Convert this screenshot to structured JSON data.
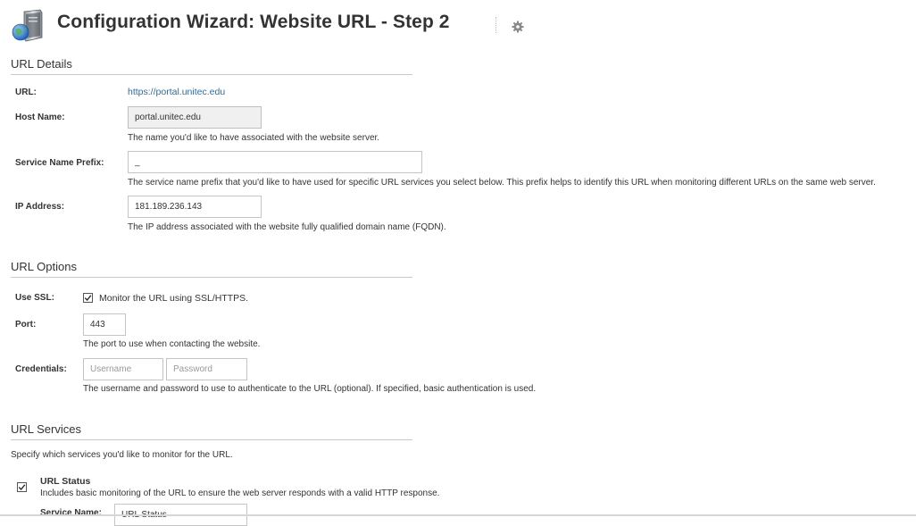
{
  "page": {
    "title": "Configuration Wizard: Website URL - Step 2",
    "icon": "server-globe-icon",
    "settings_icon": "gear-icon"
  },
  "url_details": {
    "heading": "URL Details",
    "url_label": "URL:",
    "url_value": "https://portal.unitec.edu",
    "host_name_label": "Host Name:",
    "host_name_value": "portal.unitec.edu",
    "host_name_help": "The name you'd like to have associated with the website server.",
    "prefix_label": "Service Name Prefix:",
    "prefix_value": "_",
    "prefix_help": "The service name prefix that you'd like to have used for specific URL services you select below. This prefix helps to identify this URL when monitoring different URLs on the same web server.",
    "ip_label": "IP Address:",
    "ip_value": "181.189.236.143",
    "ip_help": "The IP address associated with the website fully qualified domain name (FQDN)."
  },
  "url_options": {
    "heading": "URL Options",
    "ssl_label": "Use SSL:",
    "ssl_checked": true,
    "ssl_text": "Monitor the URL using SSL/HTTPS.",
    "port_label": "Port:",
    "port_value": "443",
    "port_help": "The port to use when contacting the website.",
    "credentials_label": "Credentials:",
    "username_placeholder": "Username",
    "password_placeholder": "Password",
    "credentials_help": "The username and password to use to authenticate to the URL (optional). If specified, basic authentication is used."
  },
  "url_services": {
    "heading": "URL Services",
    "intro": "Specify which services you'd like to monitor for the URL.",
    "services": [
      {
        "checked": true,
        "name": "URL Status",
        "description": "Includes basic monitoring of the URL to ensure the web server responds with a valid HTTP response.",
        "service_name_label": "Service Name:",
        "service_name_value": "URL Status"
      }
    ]
  },
  "colors": {
    "link": "#2b6cb0",
    "readonly_field_bg": "#f0f0f0"
  }
}
